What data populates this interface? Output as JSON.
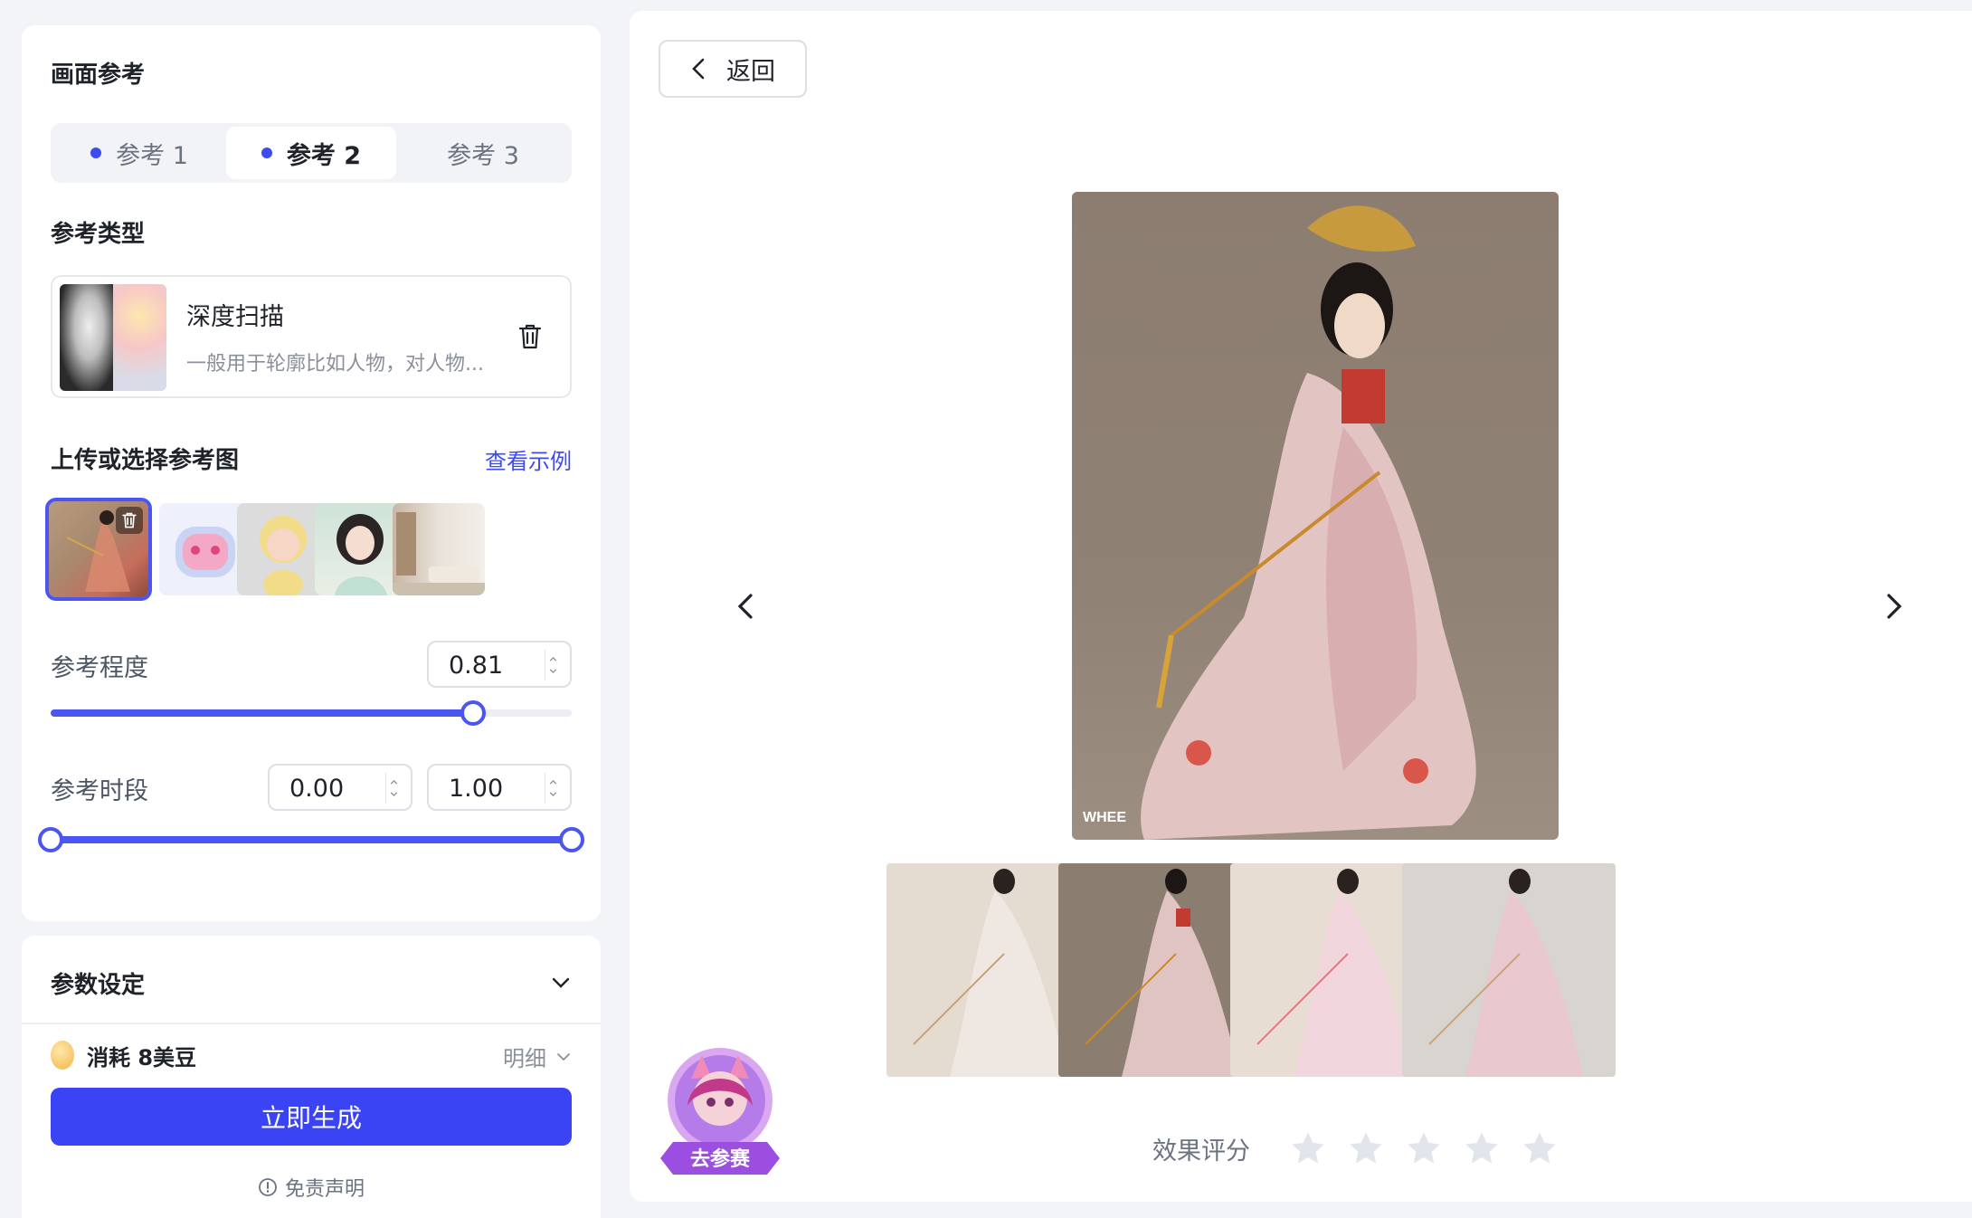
{
  "reference_panel": {
    "title": "画面参考",
    "tabs": [
      {
        "label": "参考 1",
        "active": false,
        "has_dot": true
      },
      {
        "label": "参考 2",
        "active": true,
        "has_dot": true
      },
      {
        "label": "参考 3",
        "active": false,
        "has_dot": false
      }
    ],
    "ref_type_title": "参考类型",
    "ref_type": {
      "name": "深度扫描",
      "description": "一般用于轮廓比如人物，对人物..."
    },
    "upload_title": "上传或选择参考图",
    "view_example": "查看示例",
    "thumbnails": [
      "hanfu-woman",
      "pink-robot",
      "blonde-figurine",
      "anime-girl",
      "living-room"
    ],
    "strength": {
      "label": "参考程度",
      "value": "0.81",
      "fraction": 0.81
    },
    "time_range": {
      "label": "参考时段",
      "start": "0.00",
      "end": "1.00",
      "start_fraction": 0.0,
      "end_fraction": 1.0
    }
  },
  "params_panel": {
    "title": "参数设定",
    "cost": "消耗 8美豆",
    "detail": "明细",
    "generate": "立即生成",
    "disclaimer": "免责声明"
  },
  "main": {
    "back": "返回",
    "badge": "去参赛",
    "rating_label": "效果评分",
    "stars": 5,
    "rating": 0,
    "watermark": "WHEE",
    "colors": {
      "accent": "#3a44f5",
      "star": "#e3e5ec"
    }
  }
}
